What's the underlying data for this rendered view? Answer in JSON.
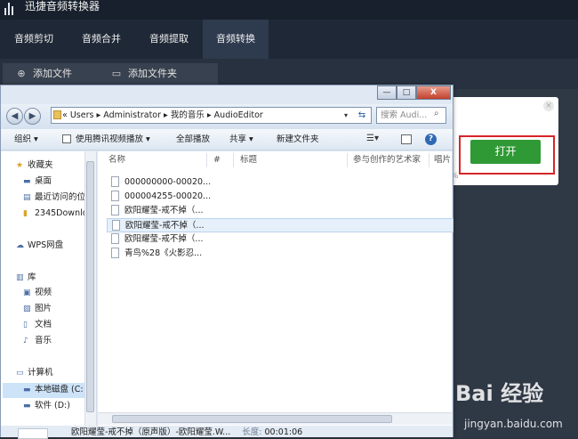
{
  "app": {
    "title": "迅捷音频转换器"
  },
  "tabs": [
    {
      "label": "音频剪切"
    },
    {
      "label": "音频合并"
    },
    {
      "label": "音频提取"
    },
    {
      "label": "音频转换",
      "active": true
    }
  ],
  "toolbar": {
    "add_file": "添加文件",
    "add_folder": "添加文件夹"
  },
  "open_panel": {
    "button_label": "打开",
    "percent_fragment": "%",
    "highlight_color": "#d6262a"
  },
  "dialog": {
    "window_controls": [
      "—",
      "□",
      "X"
    ],
    "address": {
      "prefix": "«",
      "segments": [
        "Users",
        "Administrator",
        "我的音乐",
        "AudioEditor"
      ]
    },
    "search_placeholder": "搜索 Audi...",
    "commands": {
      "organize": "组织 ▾",
      "play": "使用腾讯视频播放 ▾",
      "play_all": "全部播放",
      "share": "共享 ▾",
      "new_folder": "新建文件夹"
    },
    "nav": {
      "favorites": "收藏夹",
      "desktop": "桌面",
      "recent": "最近访问的位",
      "downloads": "2345Downlo",
      "wps": "WPS网盘",
      "library": "库",
      "videos": "视频",
      "pictures": "图片",
      "docs": "文档",
      "music": "音乐",
      "computer": "计算机",
      "local_disk": "本地磁盘 (C:",
      "soft_disk": "软件 (D:)"
    },
    "columns": [
      "名称",
      "#",
      "标题",
      "参与创作的艺术家",
      "唱片"
    ],
    "files": [
      "000000000-00020...",
      "000004255-00020...",
      "欧阳耀莹-戒不掉（...",
      "欧阳耀莹-戒不掉（...",
      "欧阳耀莹-戒不掉（...",
      "青鸟%28《火影忍..."
    ],
    "status": {
      "name": "欧阳耀莹-戒不掉（原声版）-欧阳耀莹.W...",
      "duration_label": "长度:",
      "duration": "00:01:06"
    }
  },
  "watermark": {
    "text": "Bai 经验",
    "url": "jingyan.baidu.com"
  }
}
